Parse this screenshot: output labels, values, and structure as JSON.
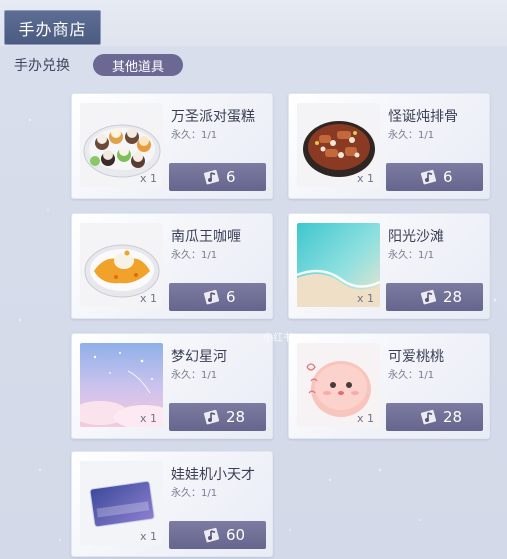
{
  "header": {
    "title": "手办商店"
  },
  "subtabs": [
    {
      "label": "手办兑换",
      "active": false
    },
    {
      "label": "其他道具",
      "active": true
    }
  ],
  "colors": {
    "accent": "#6b6894",
    "price_button": "#6f6e96",
    "tab_bg": "#566690"
  },
  "currency_icon": "music-ticket-icon",
  "items": [
    {
      "name": "万圣派对蛋糕",
      "permanence": "永久：1/1",
      "quantity": "x 1",
      "price": "6",
      "thumb": "halloween-cake-plate"
    },
    {
      "name": "怪诞炖排骨",
      "permanence": "永久：1/1",
      "quantity": "x 1",
      "price": "6",
      "thumb": "stewed-ribs-plate"
    },
    {
      "name": "南瓜王咖喱",
      "permanence": "永久：1/1",
      "quantity": "x 1",
      "price": "6",
      "thumb": "pumpkin-curry-plate"
    },
    {
      "name": "阳光沙滩",
      "permanence": "永久：1/1",
      "quantity": "x 1",
      "price": "28",
      "thumb": "sunny-beach-background"
    },
    {
      "name": "梦幻星河",
      "permanence": "永久：1/1",
      "quantity": "x 1",
      "price": "28",
      "thumb": "dreamy-starry-sky-background"
    },
    {
      "name": "可爱桃桃",
      "permanence": "永久：1/1",
      "quantity": "x 1",
      "price": "28",
      "thumb": "cute-peach-sticker"
    },
    {
      "name": "娃娃机小天才",
      "permanence": "永久：1/1",
      "quantity": "x 1",
      "price": "60",
      "thumb": "title-card"
    }
  ],
  "watermark": "小红书"
}
